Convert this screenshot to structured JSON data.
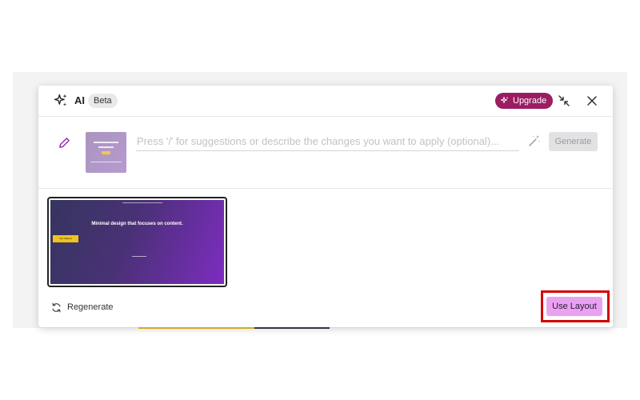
{
  "header": {
    "title": "AI",
    "badge": "Beta",
    "upgrade_label": "Upgrade",
    "sparkle_icon": "sparkle-icon",
    "collapse_icon": "collapse-icon",
    "close_icon": "close-icon"
  },
  "prompt": {
    "placeholder": "Press '/' for suggestions or describe the changes you want to apply (optional)...",
    "value": "",
    "generate_label": "Generate",
    "edit_icon": "pencil-icon",
    "wand_icon": "magic-wand-icon"
  },
  "result": {
    "headline": "Minimal design that focuses on content.",
    "cta_label": "Get Started"
  },
  "footer": {
    "regenerate_label": "Regenerate",
    "regenerate_icon": "refresh-icon",
    "use_layout_label": "Use Layout"
  },
  "colors": {
    "accent_magenta": "#9b1d62",
    "use_layout_bg": "#e9a2f2",
    "highlight_red": "#d40000",
    "preview_start": "#35355f",
    "preview_end": "#7d2cc0"
  }
}
